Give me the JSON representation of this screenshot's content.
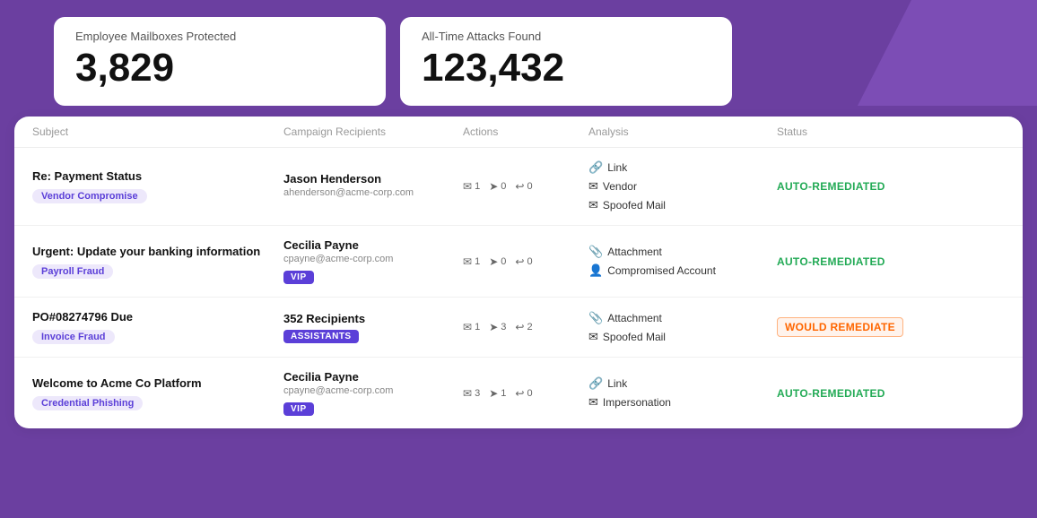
{
  "stats": {
    "mailboxes_label": "Employee Mailboxes Protected",
    "mailboxes_value": "3,829",
    "attacks_label": "All-Time Attacks Found",
    "attacks_value": "123,432"
  },
  "table": {
    "headers": {
      "subject": "Subject",
      "campaign_recipients": "Campaign Recipients",
      "actions": "Actions",
      "analysis": "Analysis",
      "status": "Status"
    },
    "rows": [
      {
        "subject": "Re: Payment Status",
        "category": "Vendor Compromise",
        "recipient_name": "Jason Henderson",
        "recipient_email": "ahenderson@acme-corp.com",
        "recipient_badge": null,
        "action_mail": "1",
        "action_send": "0",
        "action_reply": "0",
        "analysis": [
          "Link",
          "Vendor",
          "Spoofed Mail"
        ],
        "status": "AUTO-REMEDIATED",
        "status_type": "auto"
      },
      {
        "subject": "Urgent: Update your banking information",
        "category": "Payroll Fraud",
        "recipient_name": "Cecilia Payne",
        "recipient_email": "cpayne@acme-corp.com",
        "recipient_badge": "VIP",
        "action_mail": "1",
        "action_send": "0",
        "action_reply": "0",
        "analysis": [
          "Attachment",
          "Compromised Account"
        ],
        "status": "AUTO-REMEDIATED",
        "status_type": "auto"
      },
      {
        "subject": "PO#08274796 Due",
        "category": "Invoice Fraud",
        "recipient_name": "352 Recipients",
        "recipient_email": null,
        "recipient_badge": "ASSISTANTS",
        "action_mail": "1",
        "action_send": "3",
        "action_reply": "2",
        "analysis": [
          "Attachment",
          "Spoofed Mail"
        ],
        "status": "WOULD REMEDIATE",
        "status_type": "would"
      },
      {
        "subject": "Welcome to Acme Co Platform",
        "category": "Credential Phishing",
        "recipient_name": "Cecilia Payne",
        "recipient_email": "cpayne@acme-corp.com",
        "recipient_badge": "VIP",
        "action_mail": "3",
        "action_send": "1",
        "action_reply": "0",
        "analysis": [
          "Link",
          "Impersonation"
        ],
        "status": "AUTO-REMEDIATED",
        "status_type": "auto"
      }
    ]
  },
  "icons": {
    "mail": "✉",
    "send": "➤",
    "reply": "↩",
    "link": "🔗",
    "vendor": "✉",
    "attachment": "📎",
    "compromised": "👤",
    "impersonation": "✉",
    "spoofed": "✉"
  }
}
